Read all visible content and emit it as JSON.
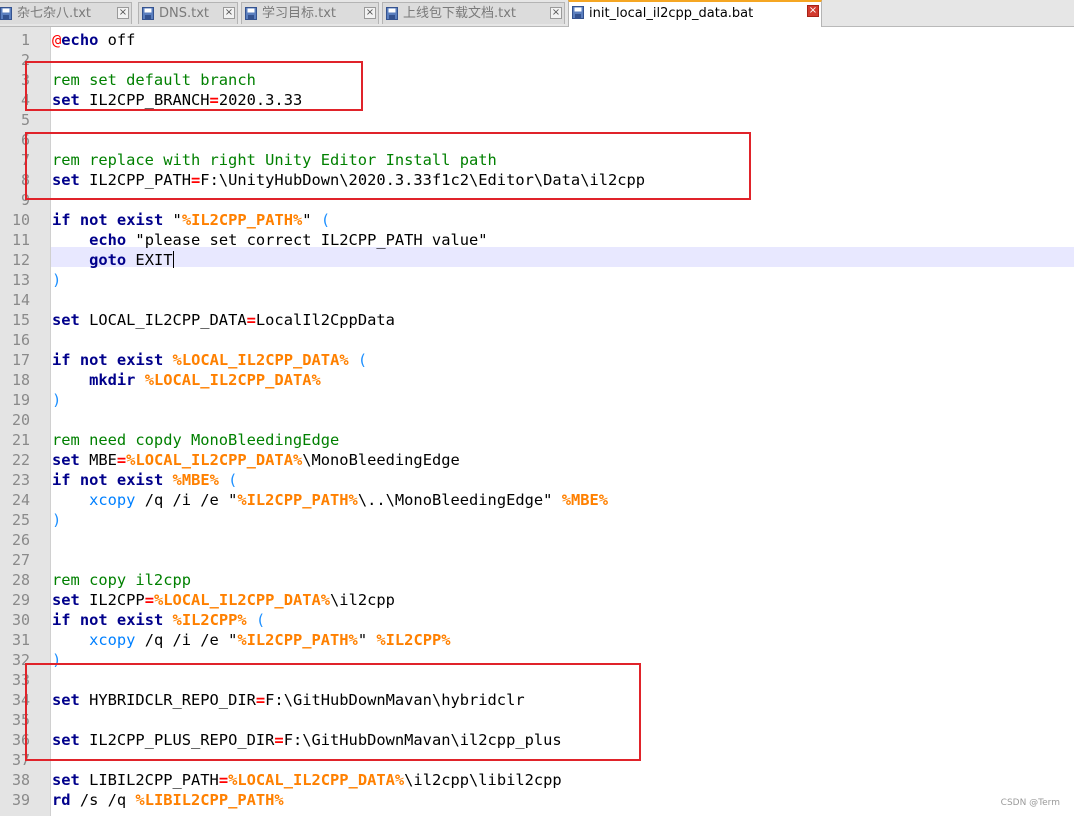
{
  "tabs": [
    {
      "label": "杂七杂八.txt",
      "active": false
    },
    {
      "label": "DNS.txt",
      "active": false
    },
    {
      "label": "学习目标.txt",
      "active": false
    },
    {
      "label": "上线包下载文档.txt",
      "active": false
    },
    {
      "label": "init_local_il2cpp_data.bat",
      "active": true
    }
  ],
  "tab_close_symbol": "×",
  "current_line": 12,
  "code": [
    [
      [
        "at",
        "@"
      ],
      [
        "kw",
        "echo"
      ],
      [
        "t",
        " off"
      ]
    ],
    [],
    [
      [
        "cm",
        "rem set default branch"
      ]
    ],
    [
      [
        "kw",
        "set"
      ],
      [
        "t",
        " IL2CPP_BRANCH"
      ],
      [
        "op",
        "="
      ],
      [
        "t",
        "2020.3.33"
      ]
    ],
    [],
    [],
    [
      [
        "cm",
        "rem replace with right Unity Editor Install path"
      ]
    ],
    [
      [
        "kw",
        "set"
      ],
      [
        "t",
        " IL2CPP_PATH"
      ],
      [
        "op",
        "="
      ],
      [
        "t",
        "F:\\UnityHubDown\\2020.3.33f1c2\\Editor\\Data\\il2cpp"
      ]
    ],
    [],
    [
      [
        "kw",
        "if"
      ],
      [
        "t",
        " "
      ],
      [
        "kw",
        "not"
      ],
      [
        "t",
        " "
      ],
      [
        "kw",
        "exist"
      ],
      [
        "t",
        " \""
      ],
      [
        "var",
        "%IL2CPP_PATH%"
      ],
      [
        "t",
        "\" "
      ],
      [
        "par",
        "("
      ]
    ],
    [
      [
        "t",
        "    "
      ],
      [
        "kw",
        "echo"
      ],
      [
        "t",
        " \"please set correct IL2CPP_PATH value\""
      ]
    ],
    [
      [
        "t",
        "    "
      ],
      [
        "kw",
        "goto"
      ],
      [
        "t",
        " EXIT"
      ]
    ],
    [
      [
        "par",
        ")"
      ]
    ],
    [],
    [
      [
        "kw",
        "set"
      ],
      [
        "t",
        " LOCAL_IL2CPP_DATA"
      ],
      [
        "op",
        "="
      ],
      [
        "t",
        "LocalIl2CppData"
      ]
    ],
    [],
    [
      [
        "kw",
        "if"
      ],
      [
        "t",
        " "
      ],
      [
        "kw",
        "not"
      ],
      [
        "t",
        " "
      ],
      [
        "kw",
        "exist"
      ],
      [
        "t",
        " "
      ],
      [
        "var",
        "%LOCAL_IL2CPP_DATA%"
      ],
      [
        "t",
        " "
      ],
      [
        "par",
        "("
      ]
    ],
    [
      [
        "t",
        "    "
      ],
      [
        "kw",
        "mkdir"
      ],
      [
        "t",
        " "
      ],
      [
        "var",
        "%LOCAL_IL2CPP_DATA%"
      ]
    ],
    [
      [
        "par",
        ")"
      ]
    ],
    [],
    [
      [
        "cm",
        "rem need copdy MonoBleedingEdge"
      ]
    ],
    [
      [
        "kw",
        "set"
      ],
      [
        "t",
        " MBE"
      ],
      [
        "op",
        "="
      ],
      [
        "var",
        "%LOCAL_IL2CPP_DATA%"
      ],
      [
        "t",
        "\\MonoBleedingEdge"
      ]
    ],
    [
      [
        "kw",
        "if"
      ],
      [
        "t",
        " "
      ],
      [
        "kw",
        "not"
      ],
      [
        "t",
        " "
      ],
      [
        "kw",
        "exist"
      ],
      [
        "t",
        " "
      ],
      [
        "var",
        "%MBE%"
      ],
      [
        "t",
        " "
      ],
      [
        "par",
        "("
      ]
    ],
    [
      [
        "t",
        "    "
      ],
      [
        "cmd2",
        "xcopy"
      ],
      [
        "t",
        " /q /i /e \""
      ],
      [
        "var",
        "%IL2CPP_PATH%"
      ],
      [
        "t",
        "\\..\\MonoBleedingEdge\" "
      ],
      [
        "var",
        "%MBE%"
      ]
    ],
    [
      [
        "par",
        ")"
      ]
    ],
    [],
    [],
    [
      [
        "cm",
        "rem copy il2cpp"
      ]
    ],
    [
      [
        "kw",
        "set"
      ],
      [
        "t",
        " IL2CPP"
      ],
      [
        "op",
        "="
      ],
      [
        "var",
        "%LOCAL_IL2CPP_DATA%"
      ],
      [
        "t",
        "\\il2cpp"
      ]
    ],
    [
      [
        "kw",
        "if"
      ],
      [
        "t",
        " "
      ],
      [
        "kw",
        "not"
      ],
      [
        "t",
        " "
      ],
      [
        "kw",
        "exist"
      ],
      [
        "t",
        " "
      ],
      [
        "var",
        "%IL2CPP%"
      ],
      [
        "t",
        " "
      ],
      [
        "par",
        "("
      ]
    ],
    [
      [
        "t",
        "    "
      ],
      [
        "cmd2",
        "xcopy"
      ],
      [
        "t",
        " /q /i /e \""
      ],
      [
        "var",
        "%IL2CPP_PATH%"
      ],
      [
        "t",
        "\" "
      ],
      [
        "var",
        "%IL2CPP%"
      ]
    ],
    [
      [
        "par",
        ")"
      ]
    ],
    [],
    [
      [
        "kw",
        "set"
      ],
      [
        "t",
        " HYBRIDCLR_REPO_DIR"
      ],
      [
        "op",
        "="
      ],
      [
        "t",
        "F:\\GitHubDownMavan\\hybridclr"
      ]
    ],
    [],
    [
      [
        "kw",
        "set"
      ],
      [
        "t",
        " IL2CPP_PLUS_REPO_DIR"
      ],
      [
        "op",
        "="
      ],
      [
        "t",
        "F:\\GitHubDownMavan\\il2cpp_plus"
      ]
    ],
    [],
    [
      [
        "kw",
        "set"
      ],
      [
        "t",
        " LIBIL2CPP_PATH"
      ],
      [
        "op",
        "="
      ],
      [
        "var",
        "%LOCAL_IL2CPP_DATA%"
      ],
      [
        "t",
        "\\il2cpp\\libil2cpp"
      ]
    ],
    [
      [
        "kw",
        "rd"
      ],
      [
        "t",
        " /s /q "
      ],
      [
        "var",
        "%LIBIL2CPP_PATH%"
      ]
    ]
  ],
  "watermark": "CSDN @Term",
  "colors": {
    "highlight_box": "#e0232a",
    "current_line_bg": "#e8e8ff",
    "keyword": "#00008b",
    "comment": "#008000",
    "variable": "#ff8000",
    "operator": "#ff0000"
  }
}
